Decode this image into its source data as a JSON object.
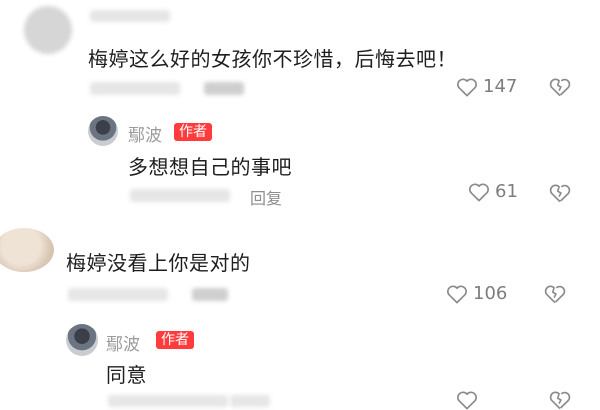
{
  "comments": [
    {
      "text": "梅婷这么好的女孩你不珍惜，后悔去吧！",
      "likes": "147",
      "replies": [
        {
          "username": "鄢波",
          "badge": "作者",
          "text": "多想想自己的事吧",
          "reply_label": "回复",
          "likes": "61"
        }
      ]
    },
    {
      "text": "梅婷没看上你是对的",
      "likes": "106",
      "replies": [
        {
          "username": "鄢波",
          "badge": "作者",
          "text": "同意"
        }
      ]
    }
  ],
  "icons": {
    "like": "heart-outline-icon",
    "dislike": "broken-heart-icon"
  }
}
